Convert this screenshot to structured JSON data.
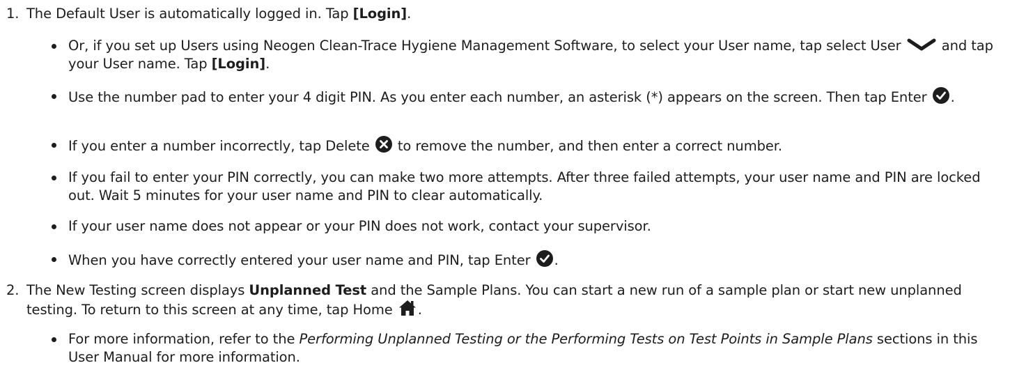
{
  "step1": {
    "number": "1.",
    "text_a": "The Default User is automatically logged in. Tap ",
    "login": "[Login]",
    "text_b": "."
  },
  "bullets1": {
    "b1_text_a": "Or, if you set up Users using Neogen Clean-Trace Hygiene Management Software, to select your User name, tap select User ",
    "b1_text_b": " and tap your User name. Tap ",
    "b1_login": "[Login]",
    "b1_text_c": ".",
    "b2_text_a": "Use the number pad to enter your 4 digit PIN. As you enter each number, an asterisk (*) appears on the screen. Then tap Enter ",
    "b2_text_b": ".",
    "b3_text_a": "If you enter a number incorrectly, tap Delete ",
    "b3_text_b": " to remove the number, and then enter a correct number.",
    "b4_text": "If you fail to enter your PIN correctly, you can make two more attempts. After three failed attempts, your user name and PIN are locked out. Wait 5 minutes for your user name and PIN to clear automatically.",
    "b5_text": "If your user name does not appear or your PIN does not work, contact your supervisor.",
    "b6_text_a": "When you have correctly entered your user name and PIN, tap Enter ",
    "b6_text_b": "."
  },
  "step2": {
    "number": "2.",
    "text_a": "The New Testing screen displays ",
    "unplanned": "Unplanned Test",
    "text_b": " and the Sample Plans. You can start a new run of a sample plan or start new unplanned testing. To return to this screen at any time, tap Home ",
    "text_c": "."
  },
  "bullets2": {
    "b1_text_a": "For more information, refer to the ",
    "b1_italic": "Performing Unplanned Testing or the Performing Tests on Test Points in Sample Plans",
    "b1_text_b": " sections in this User Manual for more information."
  },
  "icons": {
    "select": "chevron-down-icon",
    "enter": "check-circle-icon",
    "delete": "x-circle-icon",
    "home": "home-icon"
  },
  "colors": {
    "text": "#1d1d1d",
    "icon": "#1d1d1d"
  }
}
